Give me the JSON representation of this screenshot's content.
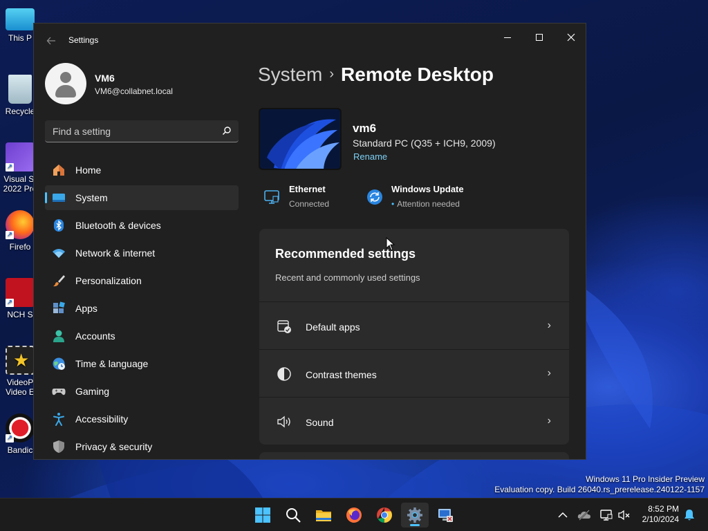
{
  "desktop": {
    "icons": [
      {
        "label": "This P",
        "name": "this-pc"
      },
      {
        "label": "Recycle",
        "name": "recycle-bin"
      },
      {
        "label": "Visual St",
        "label2": "2022 Pre",
        "name": "visual-studio"
      },
      {
        "label": "Firefo",
        "name": "firefox"
      },
      {
        "label": "NCH S",
        "name": "nch-software"
      },
      {
        "label": "VideoP",
        "label2": "Video E",
        "name": "videopad"
      },
      {
        "label": "Bandic",
        "name": "bandicam"
      }
    ],
    "watermark_line1": "Windows 11 Pro Insider Preview",
    "watermark_line2": "Evaluation copy. Build 26040.rs_prerelease.240122-1157"
  },
  "window": {
    "title": "Settings",
    "back_icon": "back-arrow-icon",
    "controls": [
      "minimize",
      "maximize",
      "close"
    ]
  },
  "profile": {
    "name": "VM6",
    "email": "VM6@collabnet.local"
  },
  "search": {
    "placeholder": "Find a setting"
  },
  "nav": {
    "items": [
      {
        "label": "Home",
        "icon": "home-icon"
      },
      {
        "label": "System",
        "icon": "system-icon",
        "active": true
      },
      {
        "label": "Bluetooth & devices",
        "icon": "bluetooth-icon"
      },
      {
        "label": "Network & internet",
        "icon": "wifi-icon"
      },
      {
        "label": "Personalization",
        "icon": "brush-icon"
      },
      {
        "label": "Apps",
        "icon": "apps-icon"
      },
      {
        "label": "Accounts",
        "icon": "account-icon"
      },
      {
        "label": "Time & language",
        "icon": "globe-clock-icon"
      },
      {
        "label": "Gaming",
        "icon": "gamepad-icon"
      },
      {
        "label": "Accessibility",
        "icon": "accessibility-icon"
      },
      {
        "label": "Privacy & security",
        "icon": "shield-icon"
      }
    ]
  },
  "content": {
    "breadcrumb_parent": "System",
    "breadcrumb_sep": "›",
    "breadcrumb_current": "Remote Desktop",
    "device": {
      "name": "vm6",
      "spec": "Standard PC (Q35 + ICH9, 2009)",
      "rename": "Rename"
    },
    "status": [
      {
        "title": "Ethernet",
        "sub": "Connected",
        "icon": "ethernet-icon"
      },
      {
        "title": "Windows Update",
        "sub": "Attention needed",
        "icon": "windows-update-icon"
      }
    ],
    "recommended": {
      "title": "Recommended settings",
      "subtitle": "Recent and commonly used settings",
      "rows": [
        {
          "label": "Default apps",
          "icon": "default-apps-icon"
        },
        {
          "label": "Contrast themes",
          "icon": "contrast-icon"
        },
        {
          "label": "Sound",
          "icon": "speaker-icon"
        }
      ],
      "chevron": "›"
    }
  },
  "taskbar": {
    "apps": [
      "start",
      "search",
      "file-explorer",
      "firefox",
      "chrome",
      "settings",
      "remote-desktop"
    ],
    "active_app": "settings",
    "clock_time": "8:52 PM",
    "clock_date": "2/10/2024"
  },
  "colors": {
    "accent": "#4cc2ff",
    "window_bg": "#202020",
    "card_bg": "#2b2b2b",
    "link": "#7dd0f5"
  }
}
